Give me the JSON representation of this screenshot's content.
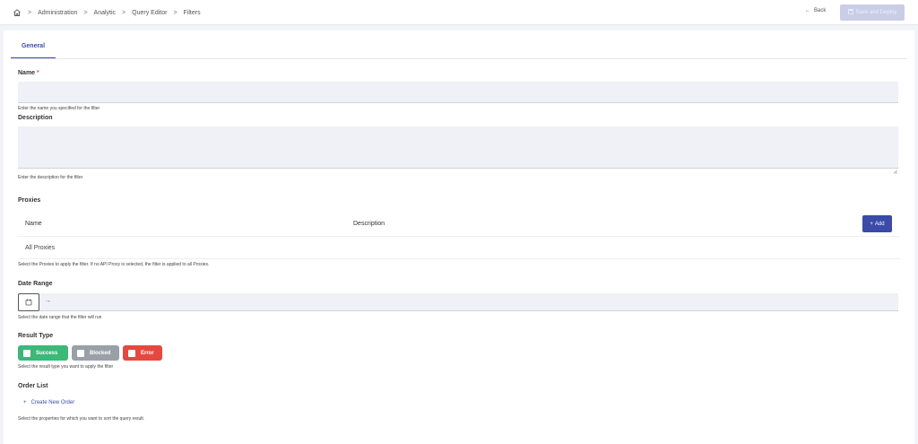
{
  "breadcrumb": {
    "items": [
      "Administration",
      "Analytic",
      "Query Editor",
      "Filters"
    ]
  },
  "header": {
    "back_label": "Back",
    "save_label": "Save and Deploy"
  },
  "tabs": [
    {
      "label": "General",
      "active": true
    }
  ],
  "form": {
    "name": {
      "label": "Name",
      "required_mark": "*",
      "value": "",
      "hint": "Enter the name you specified for the filter"
    },
    "description": {
      "label": "Description",
      "value": "",
      "hint": "Enter the description for the filter"
    },
    "proxies": {
      "label": "Proxies",
      "columns": [
        "Name",
        "Description"
      ],
      "add_label": "Add",
      "rows": [
        {
          "name": "All Proxies",
          "description": ""
        }
      ],
      "hint": "Select the Proxies to apply the filter. If no API Proxy is selected, the filter is applied to all Proxies."
    },
    "date_range": {
      "label": "Date Range",
      "arrow": "→",
      "hint": "Select the date range that the filter will run"
    },
    "result_type": {
      "label": "Result Type",
      "options": [
        {
          "label": "Success",
          "color": "#3cb878",
          "checked": false
        },
        {
          "label": "Blocked",
          "color": "#9aa0a8",
          "checked": false
        },
        {
          "label": "Error",
          "color": "#e5483f",
          "checked": false
        }
      ],
      "hint": "Select the result type you want to apply the filter"
    },
    "order_list": {
      "label": "Order List",
      "create_label": "Create New Order",
      "hint": "Select the properties for which you want to sort the query result."
    }
  },
  "colors": {
    "accent": "#3b4ba8",
    "save_disabled": "#c9cde6",
    "input_bg": "#eff1f6"
  }
}
